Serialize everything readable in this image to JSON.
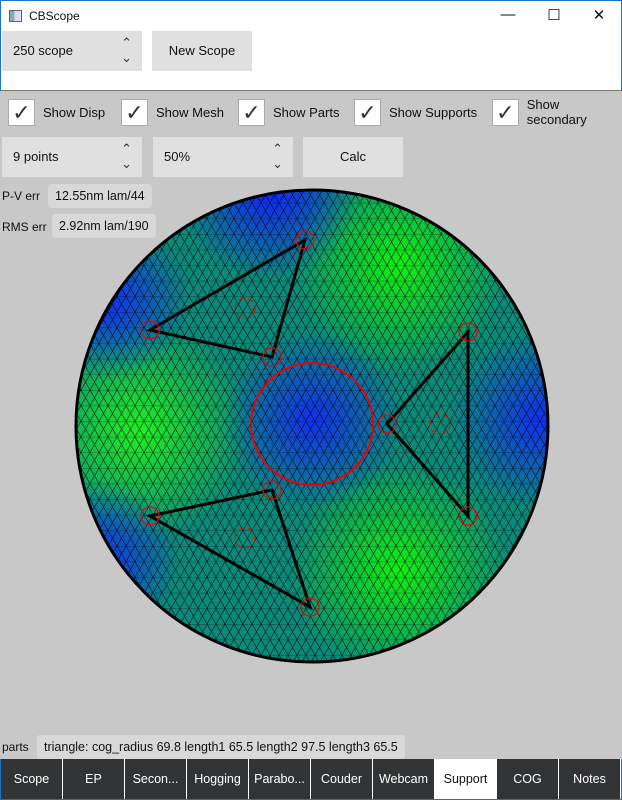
{
  "window": {
    "title": "CBScope",
    "minimize": "—",
    "maximize": "☐",
    "close": "✕"
  },
  "toolbar": {
    "scope_select": "250 scope",
    "new_scope": "New Scope"
  },
  "checkboxes": [
    {
      "label": "Show Disp",
      "checked": true
    },
    {
      "label": "Show Mesh",
      "checked": true
    },
    {
      "label": "Show Parts",
      "checked": true
    },
    {
      "label": "Show Supports",
      "checked": true
    },
    {
      "label": "Show secondary",
      "checked": true
    }
  ],
  "controls": {
    "points_select": "9 points",
    "percent_select": "50%",
    "calc": "Calc"
  },
  "errors": {
    "pv_label": "P-V err",
    "pv_value": "12.55nm lam/44",
    "rms_label": "RMS err",
    "rms_value": "2.92nm lam/190"
  },
  "parts": {
    "label": "parts",
    "value": "triangle: cog_radius 69.8 length1 65.5 length2 97.5 length3 65.5"
  },
  "tabs": [
    "Scope",
    "EP",
    "Secon...",
    "Hogging",
    "Parabo...",
    "Couder",
    "Webcam",
    "Support",
    "COG",
    "Notes"
  ],
  "active_tab": "Support",
  "check_glyph": "✓",
  "spin_glyph": "⌃⌄"
}
